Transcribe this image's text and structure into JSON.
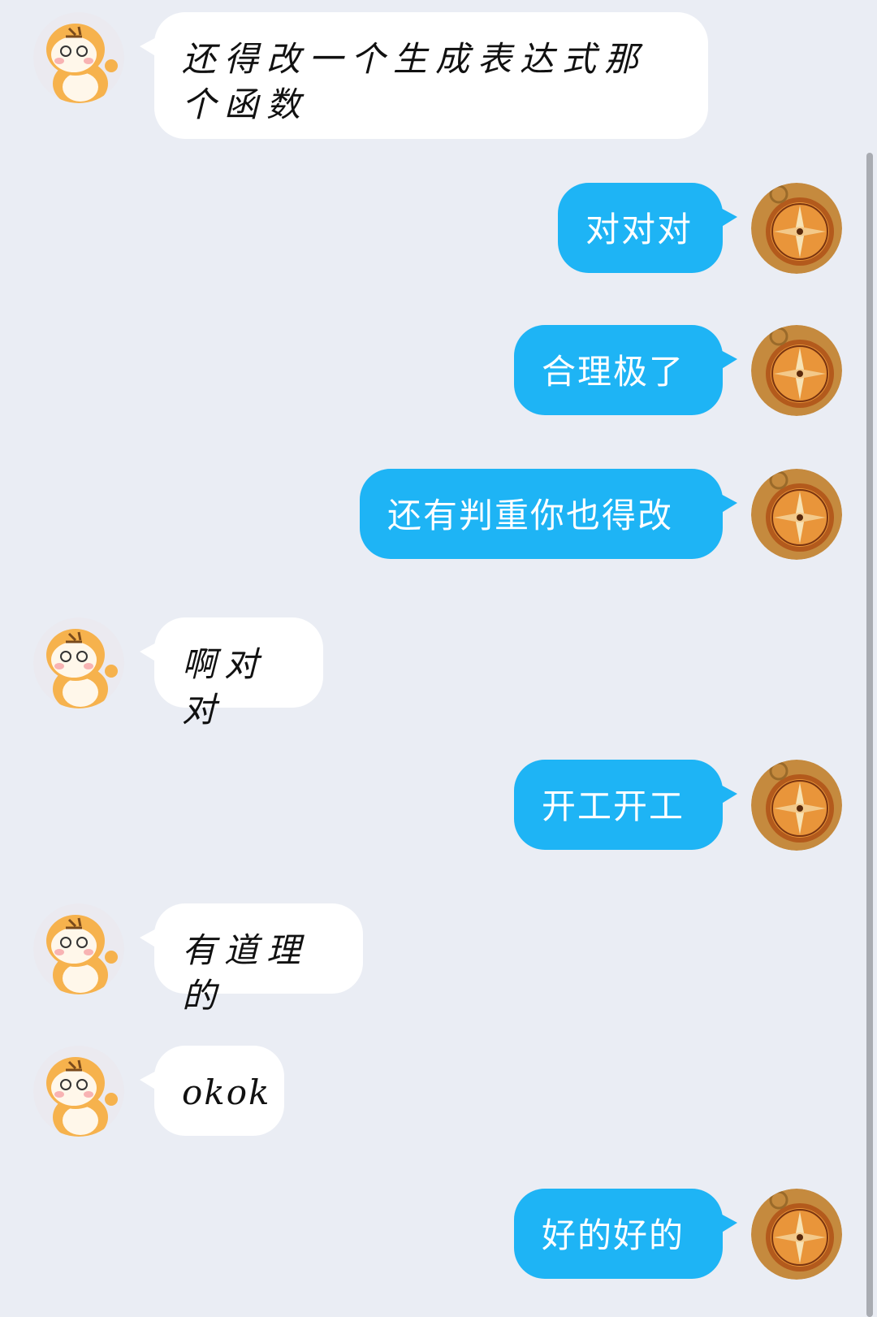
{
  "messages": [
    {
      "side": "left",
      "text": "还得改一个生成表达式那个函数"
    },
    {
      "side": "right",
      "text": "对对对"
    },
    {
      "side": "right",
      "text": "合理极了"
    },
    {
      "side": "right",
      "text": "还有判重你也得改"
    },
    {
      "side": "left",
      "text": "啊对对"
    },
    {
      "side": "right",
      "text": "开工开工"
    },
    {
      "side": "left",
      "text": "有道理的"
    },
    {
      "side": "left",
      "text": "okok"
    },
    {
      "side": "right",
      "text": "好的好的"
    }
  ],
  "avatars": {
    "left_icon": "tiger-cartoon-avatar-icon",
    "right_icon": "compass-avatar-icon"
  },
  "colors": {
    "background": "#eaedf4",
    "incoming_bubble": "#ffffff",
    "outgoing_bubble": "#1eb4f5"
  }
}
